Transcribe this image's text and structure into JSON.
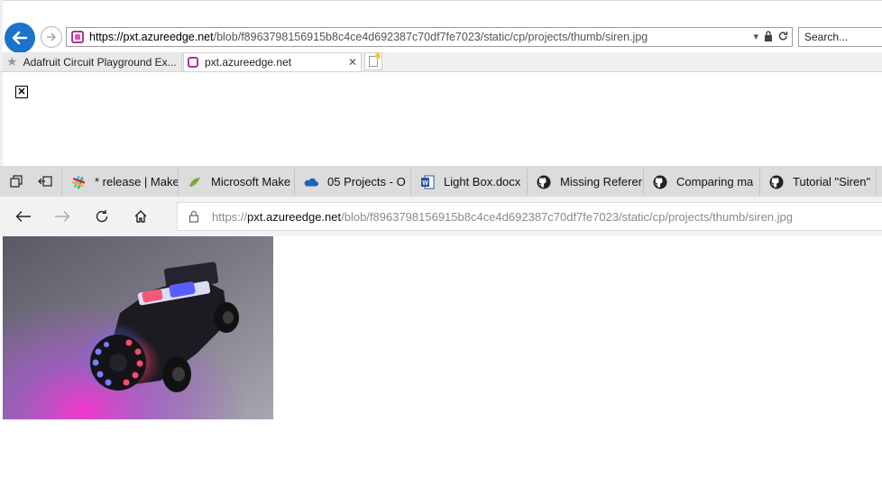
{
  "ie": {
    "address": {
      "url_prefix": "https://",
      "url_domain": "pxt.azureedge.net",
      "url_path": "/blob/f8963798156915b8c4ce4d692387c70df7fe7023/static/cp/projects/thumb/siren.jpg"
    },
    "search": {
      "placeholder": "Search..."
    },
    "tabs": [
      {
        "label": "Adafruit Circuit Playground Ex..."
      },
      {
        "label": "pxt.azureedge.net"
      }
    ]
  },
  "edge": {
    "tabs": [
      {
        "label": "* release | Make",
        "icon": "slack-icon"
      },
      {
        "label": "Microsoft Make",
        "icon": "makecode-icon"
      },
      {
        "label": "05 Projects - O",
        "icon": "onedrive-icon"
      },
      {
        "label": "Light Box.docx",
        "icon": "word-icon"
      },
      {
        "label": "Missing Referer",
        "icon": "github-icon"
      },
      {
        "label": "Comparing ma",
        "icon": "github-icon"
      },
      {
        "label": "Tutorial \"Siren\"",
        "icon": "github-icon"
      }
    ],
    "address": {
      "url_prefix": "https://",
      "url_domain": "pxt.azureedge.net",
      "url_path": "/blob/f8963798156915b8c4ce4d692387c70df7fe7023/static/cp/projects/thumb/siren.jpg"
    }
  },
  "colors": {
    "ie_accent": "#1c73c9",
    "pxt_magenta": "#b0338f"
  }
}
